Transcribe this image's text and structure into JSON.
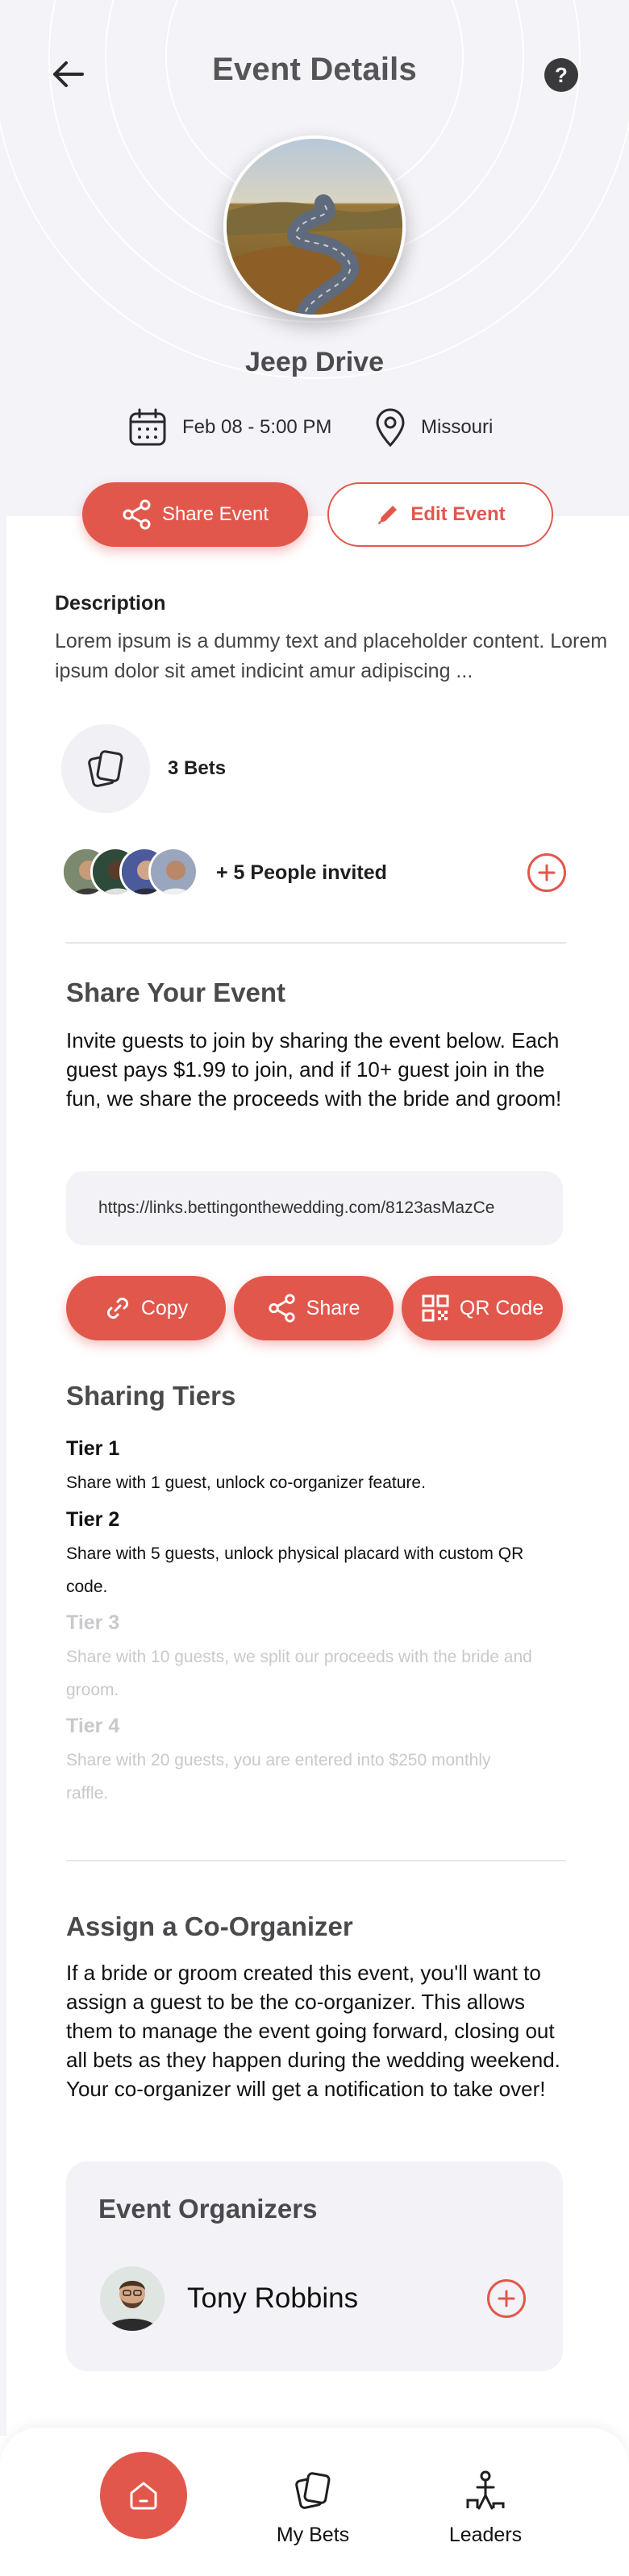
{
  "header": {
    "title": "Event Details",
    "back_icon": "arrow-left-icon",
    "help_icon": "question-circle-icon",
    "help_glyph": "?"
  },
  "event": {
    "name": "Jeep Drive",
    "date": "Feb 08 - 5:00 PM",
    "location": "Missouri",
    "share_label": "Share Event",
    "edit_label": "Edit Event"
  },
  "description": {
    "label": "Description",
    "text": "Lorem ipsum is a dummy text and placeholder content. Lorem ipsum dolor sit amet indicint amur adipiscing ..."
  },
  "bets": {
    "count_label": "3 Bets"
  },
  "invites": {
    "text": "+ 5 People invited"
  },
  "share_section": {
    "title": "Share Your Event",
    "text": "Invite guests to join by sharing the event below. Each guest pays $1.99 to join, and if 10+ guest join in the fun, we share the proceeds with the bride and groom!",
    "link": "https://links.bettingonthewedding.com/8123asMazCe",
    "copy_label": "Copy",
    "share_label": "Share",
    "qr_label": "QR Code"
  },
  "tiers": {
    "title": "Sharing Tiers",
    "items": [
      {
        "title": "Tier 1",
        "desc": "Share with 1 guest, unlock co-organizer feature.",
        "unlocked": true
      },
      {
        "title": "Tier 2",
        "desc": "Share with 5 guests, unlock physical placard with custom QR code.",
        "unlocked": true
      },
      {
        "title": "Tier 3",
        "desc": "Share with 10 guests, we split our proceeds with the bride and groom.",
        "unlocked": false
      },
      {
        "title": "Tier 4",
        "desc": "Share with 20 guests, you are entered into $250 monthly raffle.",
        "unlocked": false
      }
    ]
  },
  "coorganizer": {
    "title": "Assign a Co-Organizer",
    "text": "If a bride or groom created this event, you'll want to assign a guest to be the co-organizer. This allows them to manage the event going forward, closing out all bets as they happen during the wedding weekend. Your co-organizer will get a notification to take over!",
    "card_title": "Event Organizers",
    "organizer_name": "Tony Robbins"
  },
  "tabbar": {
    "items": [
      {
        "label": "",
        "icon": "home-icon",
        "active": true
      },
      {
        "label": "My Bets",
        "icon": "cards-icon",
        "active": false
      },
      {
        "label": "Leaders",
        "icon": "podium-icon",
        "active": false
      }
    ]
  },
  "colors": {
    "accent": "#e2574c",
    "hero_bg": "#f3f3f8",
    "card_bg": "#f2f2f7",
    "heading": "#4a4a4d",
    "muted_tier": "#c9c9cd"
  }
}
